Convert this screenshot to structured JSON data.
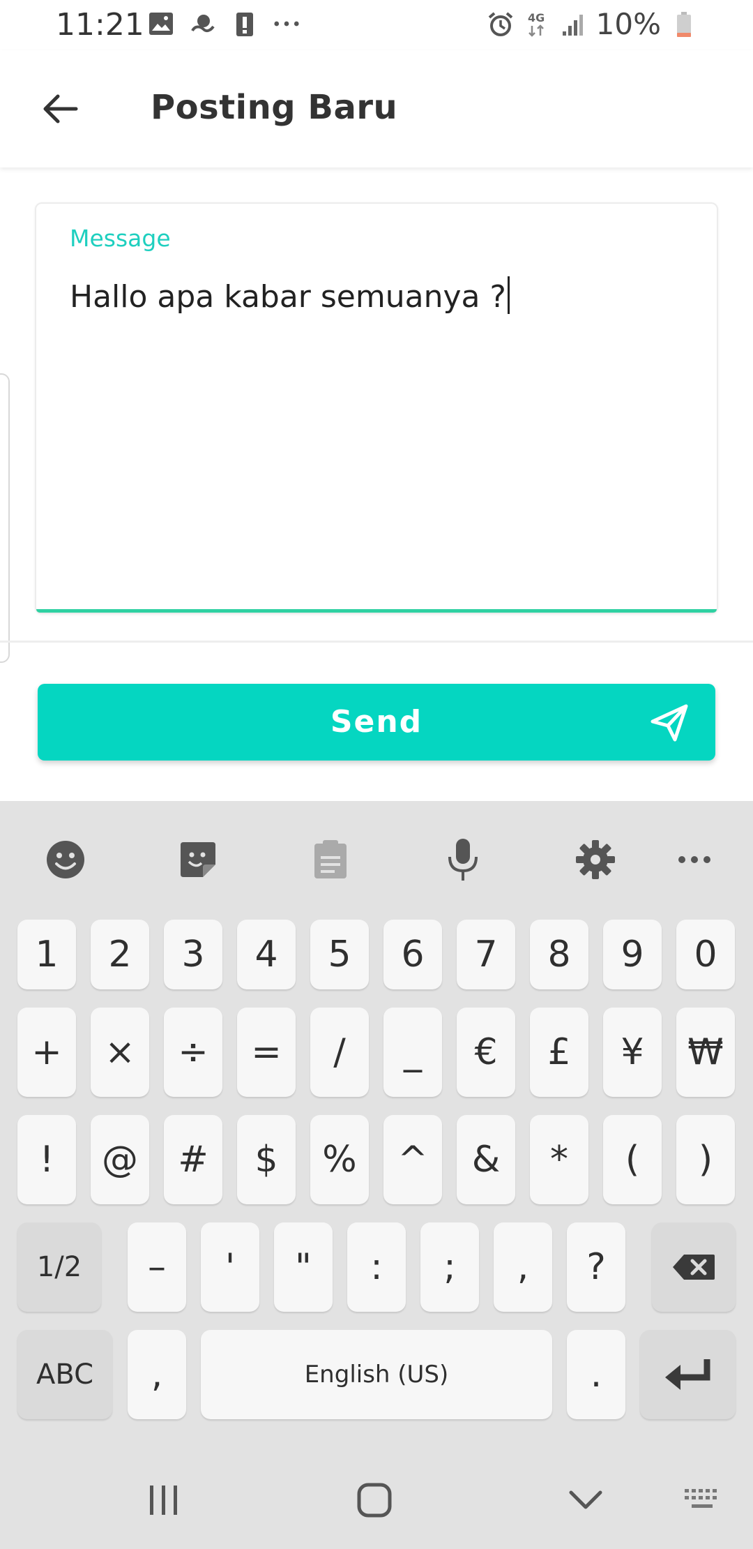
{
  "status_bar": {
    "time": "11:21",
    "left_icons": [
      "image-icon",
      "weather-icon",
      "alert-icon",
      "more-dots-icon"
    ],
    "right_icons": [
      "alarm-icon",
      "4g-icon",
      "signal-icon"
    ],
    "battery_text": "10%"
  },
  "app_bar": {
    "title": "Posting Baru",
    "back_icon": "arrow-left-icon"
  },
  "message": {
    "label": "Message",
    "value": "Hallo apa kabar semuanya ?",
    "accent_color": "#1ecfbf",
    "underline_color": "#2fd1a2"
  },
  "send_button": {
    "label": "Send",
    "icon": "paper-plane-icon",
    "color": "#05d6c1"
  },
  "keyboard": {
    "toolbar": [
      "emoji-icon",
      "sticker-icon",
      "clipboard-icon",
      "microphone-icon",
      "settings-icon",
      "more-icon"
    ],
    "row_numbers": [
      "1",
      "2",
      "3",
      "4",
      "5",
      "6",
      "7",
      "8",
      "9",
      "0"
    ],
    "row_symbols_1": [
      "+",
      "×",
      "÷",
      "=",
      "/",
      "_",
      "€",
      "£",
      "¥",
      "₩"
    ],
    "row_symbols_2": [
      "!",
      "@",
      "#",
      "$",
      "%",
      "^",
      "&",
      "*",
      "(",
      ")"
    ],
    "row_symbols_3": {
      "page_key": "1/2",
      "keys": [
        "–",
        "'",
        "\"",
        ":",
        ";",
        ",",
        "?"
      ],
      "backspace_icon": "backspace-icon"
    },
    "row_bottom": {
      "abc_key": "ABC",
      "comma_key": ",",
      "space_label": "English (US)",
      "period_key": ".",
      "enter_icon": "enter-icon"
    }
  },
  "nav_bar": {
    "items": [
      "recent-apps-icon",
      "home-icon",
      "back-chevron-icon",
      "keyboard-icon"
    ]
  }
}
